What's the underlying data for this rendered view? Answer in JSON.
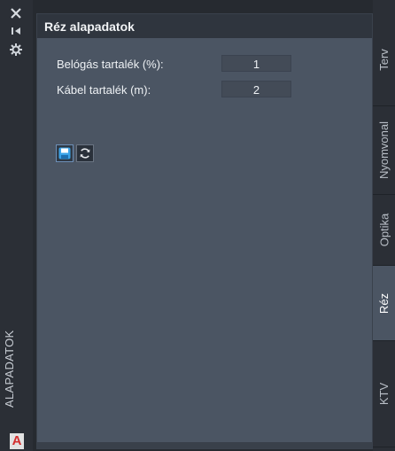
{
  "left_strip": {
    "icons": [
      "close-icon",
      "collapse-icon",
      "settings-icon"
    ],
    "vertical_title": "ALAPADATOK",
    "app_logo_letter": "A"
  },
  "panel": {
    "title": "Réz alapadatok",
    "fields": [
      {
        "label": "Belógás tartalék (%):",
        "value": "1"
      },
      {
        "label": "Kábel tartalék (m):",
        "value": "2"
      }
    ],
    "toolbar": [
      "save-icon",
      "refresh-icon"
    ]
  },
  "tabs": [
    {
      "label": "Terv",
      "active": false
    },
    {
      "label": "Nyomvonal",
      "active": false
    },
    {
      "label": "Optika",
      "active": false
    },
    {
      "label": "Réz",
      "active": true
    },
    {
      "label": "KTV",
      "active": false
    }
  ],
  "colors": {
    "panel_bg": "#4b5563",
    "header_bg": "#2f353e",
    "strip_bg": "#2b2f36",
    "logo_red": "#d32f2f"
  }
}
